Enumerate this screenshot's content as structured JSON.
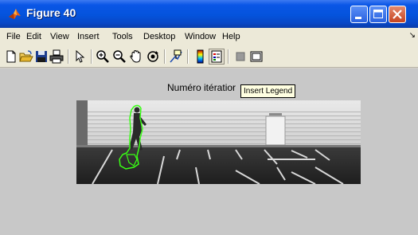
{
  "window": {
    "title": "Figure 40"
  },
  "menu": {
    "items": [
      "File",
      "Edit",
      "View",
      "Insert",
      "Tools",
      "Desktop",
      "Window",
      "Help"
    ],
    "overflow": "↘"
  },
  "toolbar": {
    "buttons": [
      "new-figure-icon",
      "open-file-icon",
      "save-icon",
      "print-icon",
      "edit-plot-arrow-icon",
      "zoom-in-icon",
      "zoom-out-icon",
      "pan-hand-icon",
      "rotate-3d-icon",
      "data-cursor-icon",
      "insert-colorbar-icon",
      "insert-legend-icon",
      "hide-plot-tools-icon",
      "show-plot-tools-icon"
    ],
    "hovered": "insert-legend-icon"
  },
  "figure": {
    "axes_title": "Numéro itératior",
    "tooltip": "Insert Legend",
    "background_color": "#c8c8c8",
    "contour_color": "#39ff14"
  }
}
